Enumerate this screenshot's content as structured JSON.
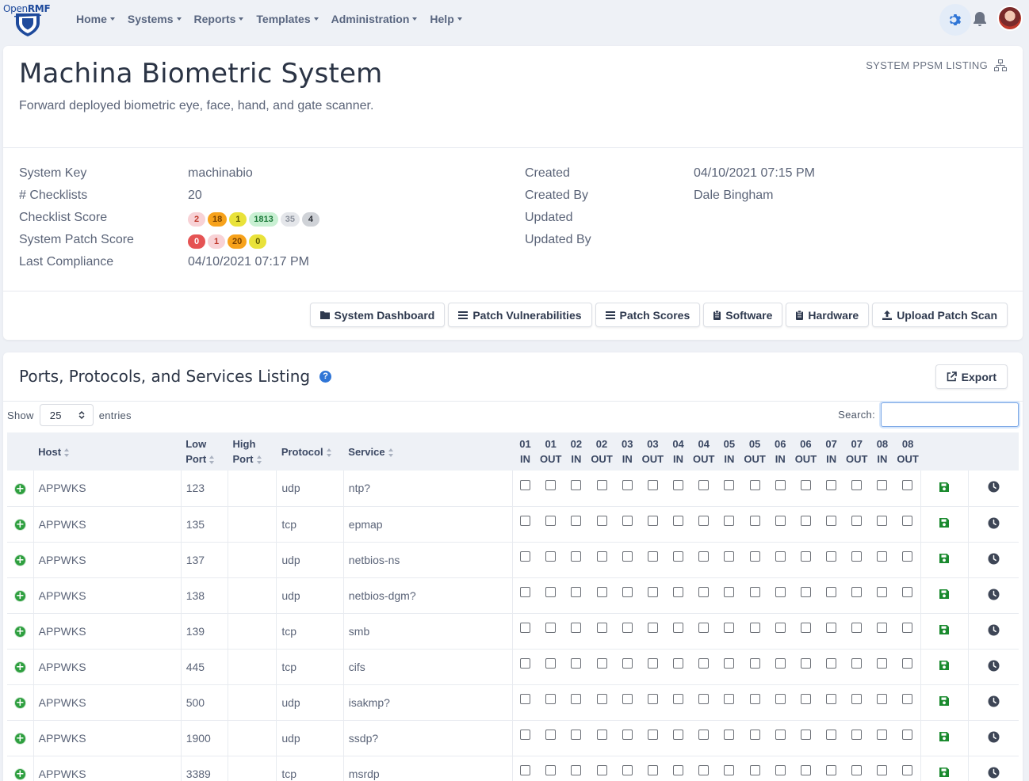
{
  "brand": {
    "text_plain": "Open",
    "text_bold": "RMF"
  },
  "nav": [
    {
      "label": "Home"
    },
    {
      "label": "Systems"
    },
    {
      "label": "Reports"
    },
    {
      "label": "Templates"
    },
    {
      "label": "Administration"
    },
    {
      "label": "Help"
    }
  ],
  "system": {
    "title": "Machina Biometric System",
    "description": "Forward deployed biometric eye, face, hand, and gate scanner.",
    "ppsm_link": "SYSTEM PPSM LISTING",
    "info_left": {
      "system_key_label": "System Key",
      "system_key": "machinabio",
      "checklists_label": "# Checklists",
      "checklists": "20",
      "checklist_score_label": "Checklist Score",
      "patch_score_label": "System Patch Score",
      "last_compliance_label": "Last Compliance",
      "last_compliance": "04/10/2021 07:17 PM"
    },
    "info_right": {
      "created_label": "Created",
      "created": "04/10/2021 07:15 PM",
      "created_by_label": "Created By",
      "created_by": "Dale Bingham",
      "updated_label": "Updated",
      "updated_by_label": "Updated By"
    },
    "checklist_badges": [
      {
        "value": "2",
        "bg": "#f8d2d6",
        "fg": "#c0392b"
      },
      {
        "value": "18",
        "bg": "#f7a21b",
        "fg": "#7a4200"
      },
      {
        "value": "1",
        "bg": "#e9e23a",
        "fg": "#5d5a00"
      },
      {
        "value": "1813",
        "bg": "#c9f0d3",
        "fg": "#1c7a3a"
      },
      {
        "value": "35",
        "bg": "#e4e6ea",
        "fg": "#8a909b"
      },
      {
        "value": "4",
        "bg": "#cfd2d7",
        "fg": "#2b2f36"
      }
    ],
    "patch_badges": [
      {
        "value": "0",
        "bg": "#e55353",
        "fg": "#ffffff"
      },
      {
        "value": "1",
        "bg": "#f8d2d6",
        "fg": "#c0392b"
      },
      {
        "value": "20",
        "bg": "#f7a21b",
        "fg": "#7a4200"
      },
      {
        "value": "0",
        "bg": "#e9e23a",
        "fg": "#5d5a00"
      }
    ],
    "buttons": [
      {
        "label": "System Dashboard",
        "icon": "folder-icon"
      },
      {
        "label": "Patch Vulnerabilities",
        "icon": "list-icon"
      },
      {
        "label": "Patch Scores",
        "icon": "list-icon"
      },
      {
        "label": "Software",
        "icon": "clipboard-icon"
      },
      {
        "label": "Hardware",
        "icon": "clipboard-icon"
      },
      {
        "label": "Upload Patch Scan",
        "icon": "upload-icon"
      }
    ]
  },
  "ppsm": {
    "title": "Ports, Protocols, and Services Listing",
    "export_label": "Export",
    "show_label": "Show",
    "entries_value": "25",
    "entries_label": "entries",
    "search_label": "Search:",
    "search_value": "",
    "columns": {
      "host": "Host",
      "low_port": [
        "Low",
        "Port"
      ],
      "high_port": [
        "High",
        "Port"
      ],
      "protocol": "Protocol",
      "service": "Service",
      "boundaries": [
        [
          "01",
          "IN"
        ],
        [
          "01",
          "OUT"
        ],
        [
          "02",
          "IN"
        ],
        [
          "02",
          "OUT"
        ],
        [
          "03",
          "IN"
        ],
        [
          "03",
          "OUT"
        ],
        [
          "04",
          "IN"
        ],
        [
          "04",
          "OUT"
        ],
        [
          "05",
          "IN"
        ],
        [
          "05",
          "OUT"
        ],
        [
          "06",
          "IN"
        ],
        [
          "06",
          "OUT"
        ],
        [
          "07",
          "IN"
        ],
        [
          "07",
          "OUT"
        ],
        [
          "08",
          "IN"
        ],
        [
          "08",
          "OUT"
        ]
      ]
    },
    "rows": [
      {
        "host": "APPWKS",
        "low_port": "123",
        "high_port": "",
        "protocol": "udp",
        "service": "ntp?"
      },
      {
        "host": "APPWKS",
        "low_port": "135",
        "high_port": "",
        "protocol": "tcp",
        "service": "epmap"
      },
      {
        "host": "APPWKS",
        "low_port": "137",
        "high_port": "",
        "protocol": "udp",
        "service": "netbios-ns"
      },
      {
        "host": "APPWKS",
        "low_port": "138",
        "high_port": "",
        "protocol": "udp",
        "service": "netbios-dgm?"
      },
      {
        "host": "APPWKS",
        "low_port": "139",
        "high_port": "",
        "protocol": "tcp",
        "service": "smb"
      },
      {
        "host": "APPWKS",
        "low_port": "445",
        "high_port": "",
        "protocol": "tcp",
        "service": "cifs"
      },
      {
        "host": "APPWKS",
        "low_port": "500",
        "high_port": "",
        "protocol": "udp",
        "service": "isakmp?"
      },
      {
        "host": "APPWKS",
        "low_port": "1900",
        "high_port": "",
        "protocol": "udp",
        "service": "ssdp?"
      },
      {
        "host": "APPWKS",
        "low_port": "3389",
        "high_port": "",
        "protocol": "tcp",
        "service": "msrdp"
      }
    ]
  }
}
